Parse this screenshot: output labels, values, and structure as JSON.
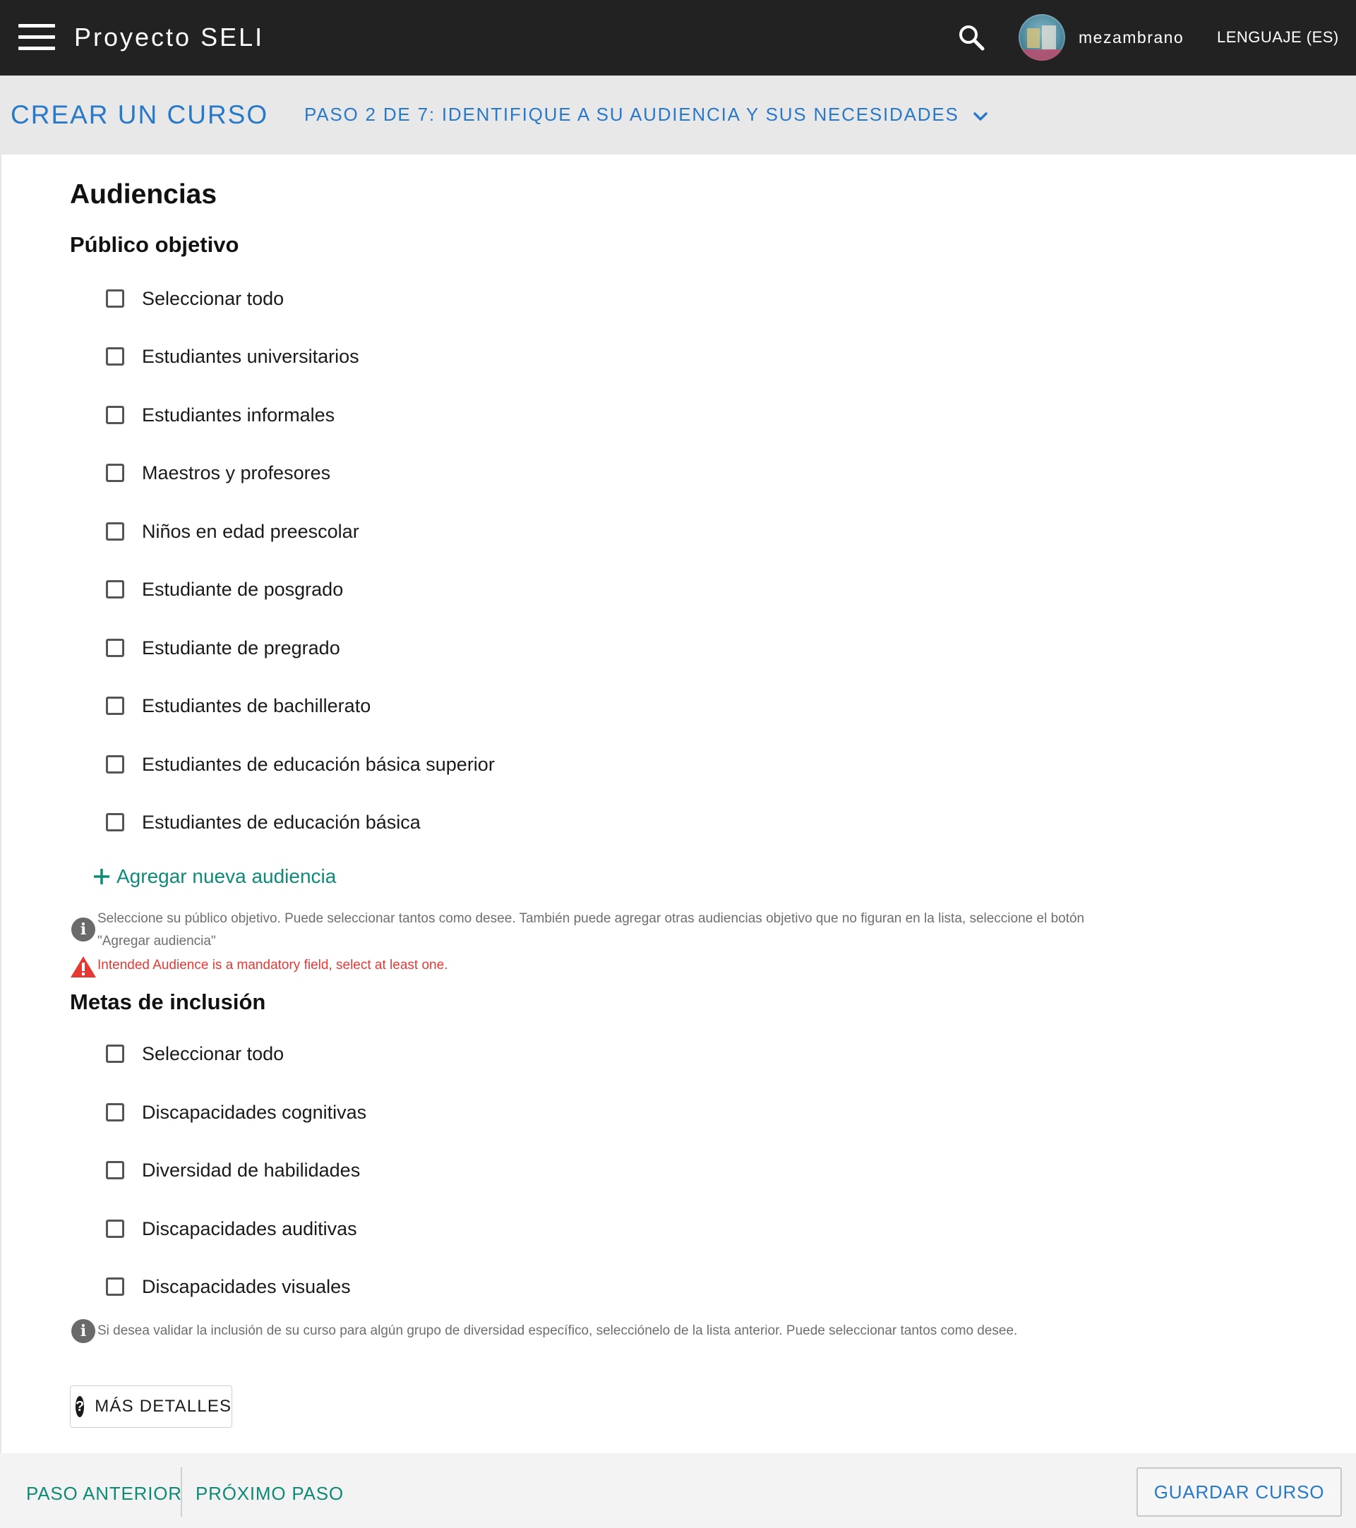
{
  "appbar": {
    "title": "Proyecto SELI",
    "username": "mezambrano",
    "language": "LENGUAJE (ES)",
    "icons": [
      "menu-icon",
      "search-icon",
      "avatar"
    ]
  },
  "stepbar": {
    "title": "CREAR UN CURSO",
    "step": "PASO 2 DE 7: IDENTIFIQUE A SU AUDIENCIA Y SUS NECESIDADES"
  },
  "content": {
    "heading": "Audiencias",
    "audience": {
      "heading": "Público objetivo",
      "options": [
        {
          "label": "Seleccionar todo",
          "checked": false
        },
        {
          "label": "Estudiantes universitarios",
          "checked": false
        },
        {
          "label": "Estudiantes informales",
          "checked": false
        },
        {
          "label": "Maestros y profesores",
          "checked": false
        },
        {
          "label": "Niños en edad preescolar",
          "checked": false
        },
        {
          "label": "Estudiante de posgrado",
          "checked": false
        },
        {
          "label": "Estudiante de pregrado",
          "checked": false
        },
        {
          "label": "Estudiantes de bachillerato",
          "checked": false
        },
        {
          "label": "Estudiantes de educación básica superior",
          "checked": false
        },
        {
          "label": "Estudiantes de educación básica",
          "checked": false
        }
      ],
      "add_label": "Agregar nueva audiencia",
      "help_line1": "Seleccione su público objetivo. Puede seleccionar tantos como desee. También puede agregar otras audiencias objetivo que no figuran en la lista, seleccione el botón",
      "help_line2": "\"Agregar audiencia\"",
      "error": "Intended Audience is a mandatory field, select at least one."
    },
    "inclusion": {
      "heading": "Metas de inclusión",
      "options": [
        {
          "label": "Seleccionar todo",
          "checked": false
        },
        {
          "label": "Discapacidades cognitivas",
          "checked": false
        },
        {
          "label": "Diversidad de habilidades",
          "checked": false
        },
        {
          "label": "Discapacidades auditivas",
          "checked": false
        },
        {
          "label": "Discapacidades visuales",
          "checked": false
        }
      ],
      "help": "Si desea validar la inclusión de su curso para algún grupo de diversidad específico, selecciónelo de la lista anterior. Puede seleccionar tantos como desee."
    },
    "more_details": "MÁS DETALLES"
  },
  "footer": {
    "prev": "PASO ANTERIOR",
    "next": "PRÓXIMO PASO",
    "save": "GUARDAR CURSO"
  },
  "colors": {
    "appbar_bg": "#222222",
    "stepbar_bg": "#e8e8e8",
    "link_blue": "#2979c9",
    "teal": "#0f8a77",
    "error_red": "#e53935"
  }
}
